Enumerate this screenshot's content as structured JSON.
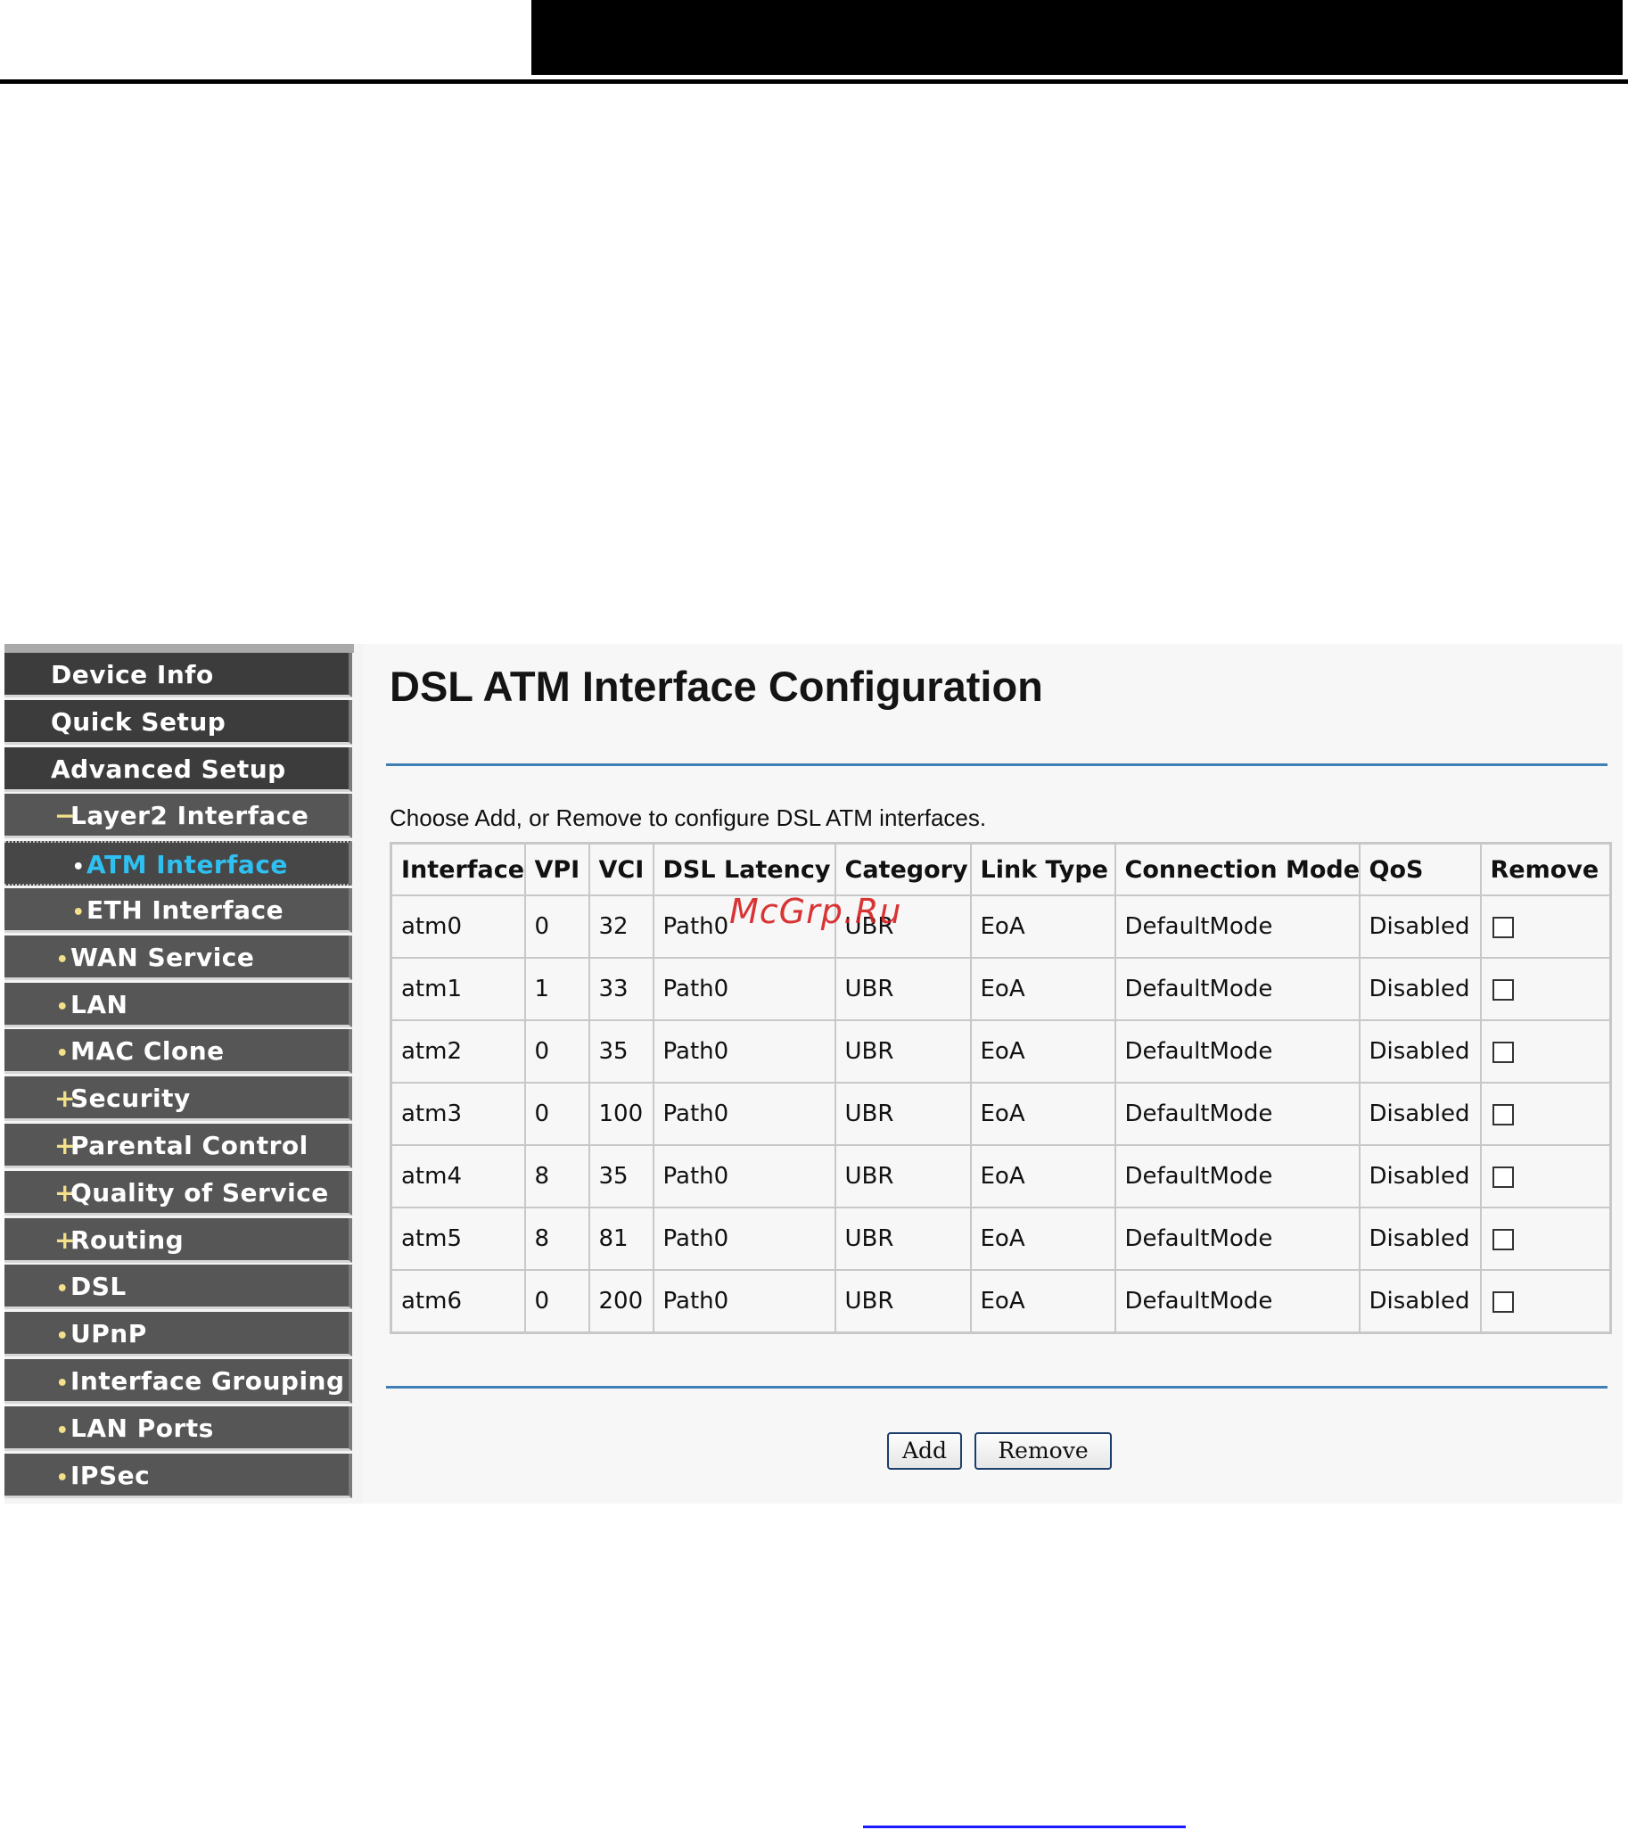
{
  "sidebar": {
    "items": [
      {
        "label": "Device Info",
        "level": "top",
        "bullet": ""
      },
      {
        "label": "Quick Setup",
        "level": "top",
        "bullet": ""
      },
      {
        "label": "Advanced Setup",
        "level": "top",
        "bullet": ""
      },
      {
        "label": "Layer2 Interface",
        "level": "lvl1",
        "bullet": "−"
      },
      {
        "label": "ATM Interface",
        "level": "lvl2",
        "bullet": "•",
        "active": true
      },
      {
        "label": "ETH Interface",
        "level": "lvl2",
        "bullet": "•"
      },
      {
        "label": "WAN Service",
        "level": "lvl1",
        "bullet": "•"
      },
      {
        "label": "LAN",
        "level": "lvl1",
        "bullet": "•"
      },
      {
        "label": "MAC Clone",
        "level": "lvl1",
        "bullet": "•"
      },
      {
        "label": "Security",
        "level": "lvl1",
        "bullet": "+"
      },
      {
        "label": "Parental Control",
        "level": "lvl1",
        "bullet": "+"
      },
      {
        "label": "Quality of Service",
        "level": "lvl1",
        "bullet": "+"
      },
      {
        "label": "Routing",
        "level": "lvl1",
        "bullet": "+"
      },
      {
        "label": "DSL",
        "level": "lvl1",
        "bullet": "•"
      },
      {
        "label": "UPnP",
        "level": "lvl1",
        "bullet": "•"
      },
      {
        "label": "Interface Grouping",
        "level": "lvl1",
        "bullet": "•"
      },
      {
        "label": "LAN Ports",
        "level": "lvl1",
        "bullet": "•"
      },
      {
        "label": "IPSec",
        "level": "lvl1",
        "bullet": "•"
      }
    ]
  },
  "main": {
    "title": "DSL ATM Interface Configuration",
    "instructions": "Choose Add, or Remove to configure DSL ATM interfaces.",
    "table": {
      "headers": [
        "Interface",
        "VPI",
        "VCI",
        "DSL Latency",
        "Category",
        "Link Type",
        "Connection Mode",
        "QoS",
        "Remove"
      ],
      "rows": [
        [
          "atm0",
          "0",
          "32",
          "Path0",
          "UBR",
          "EoA",
          "DefaultMode",
          "Disabled"
        ],
        [
          "atm1",
          "1",
          "33",
          "Path0",
          "UBR",
          "EoA",
          "DefaultMode",
          "Disabled"
        ],
        [
          "atm2",
          "0",
          "35",
          "Path0",
          "UBR",
          "EoA",
          "DefaultMode",
          "Disabled"
        ],
        [
          "atm3",
          "0",
          "100",
          "Path0",
          "UBR",
          "EoA",
          "DefaultMode",
          "Disabled"
        ],
        [
          "atm4",
          "8",
          "35",
          "Path0",
          "UBR",
          "EoA",
          "DefaultMode",
          "Disabled"
        ],
        [
          "atm5",
          "8",
          "81",
          "Path0",
          "UBR",
          "EoA",
          "DefaultMode",
          "Disabled"
        ],
        [
          "atm6",
          "0",
          "200",
          "Path0",
          "UBR",
          "EoA",
          "DefaultMode",
          "Disabled"
        ]
      ]
    },
    "buttons": {
      "add": "Add",
      "remove": "Remove"
    }
  },
  "watermark": "McGrp.Ru",
  "colors": {
    "accent_rule": "#3f7fb5",
    "active_nav": "#2fc0f2",
    "nav_bg": "#565656",
    "watermark": "#d62020"
  }
}
